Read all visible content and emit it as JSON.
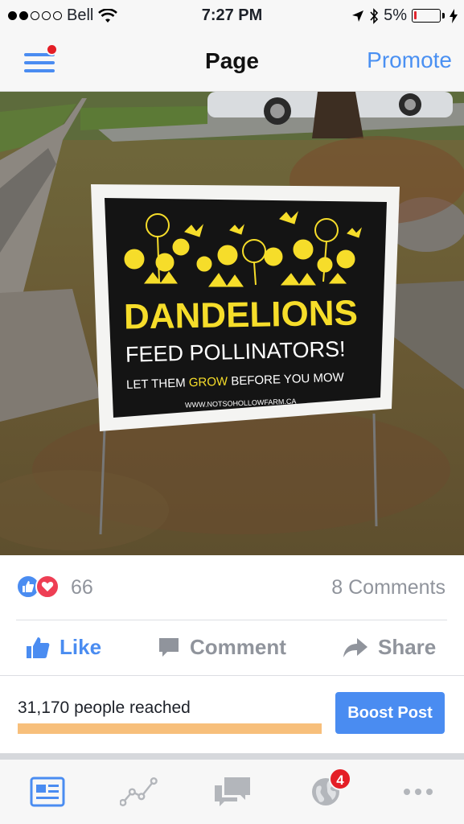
{
  "status_bar": {
    "carrier": "Bell",
    "time": "7:27 PM",
    "battery": "5%",
    "battery_level": 0.05,
    "signal_bars_filled": 2,
    "signal_bars_total": 5
  },
  "nav": {
    "title": "Page",
    "promote": "Promote",
    "menu_has_notification": true
  },
  "post": {
    "image": {
      "sign": {
        "headline": "DANDELIONS",
        "subheadline": "FEED POLLINATORS!",
        "tagline_before": "LET THEM ",
        "tagline_highlight": "GROW",
        "tagline_after": " BEFORE YOU MOW",
        "website": "WWW.NOTSOHOLLOWFARM.CA"
      }
    },
    "reaction_count": "66",
    "comments_count": "8 Comments",
    "actions": {
      "like": "Like",
      "comment": "Comment",
      "share": "Share"
    },
    "reach": {
      "text": "31,170 people reached",
      "progress": 1.0
    },
    "boost_label": "Boost Post"
  },
  "tab_bar": {
    "notifications_badge": "4"
  },
  "colors": {
    "accent": "#4a8cf1",
    "badge": "#e41e26",
    "reach_bar": "#f7bf7b",
    "sign_yellow": "#f6dd2a"
  }
}
